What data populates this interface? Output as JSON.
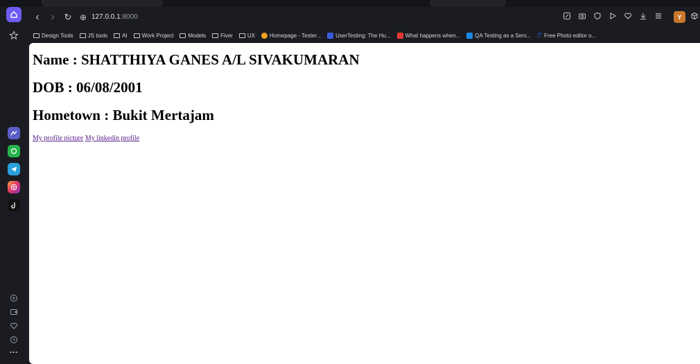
{
  "browser": {
    "url_host": "127.0.0.1",
    "url_port": ":8000",
    "profile_initial": "Y"
  },
  "toolbar": {
    "back": "‹",
    "forward": "›",
    "reload": "↻",
    "site_info": "⊕"
  },
  "bookmarks": [
    {
      "label": "Design Tools",
      "kind": "folder"
    },
    {
      "label": "JS tools",
      "kind": "folder"
    },
    {
      "label": "AI",
      "kind": "folder"
    },
    {
      "label": "Work Project",
      "kind": "folder"
    },
    {
      "label": "Models",
      "kind": "folder"
    },
    {
      "label": "Fiver",
      "kind": "folder"
    },
    {
      "label": "UX",
      "kind": "folder"
    },
    {
      "label": "Homepage - Tester...",
      "kind": "site",
      "color": "#f4a11d"
    },
    {
      "label": "UserTesting: The Hu...",
      "kind": "site",
      "color": "#3b5bdb"
    },
    {
      "label": "What happens when...",
      "kind": "site",
      "color": "#e53935"
    },
    {
      "label": "QA Testing as a Serv...",
      "kind": "site",
      "color": "#1e88e5"
    },
    {
      "label": "Free Photo editor o...",
      "kind": "site",
      "color": "#2962ff"
    }
  ],
  "page": {
    "name": "Name : SHATTHIYA GANES A/L SIVAKUMARAN",
    "dob": "DOB : 06/08/2001",
    "hometown": "Hometown : Bukit Mertajam",
    "link_picture": "My profile picture",
    "link_linkedin": "My linkedin profile"
  },
  "colors": {
    "accent": "#6e5cf6",
    "chrome_bg": "#1b1c21",
    "visited_link": "#551a8b"
  }
}
